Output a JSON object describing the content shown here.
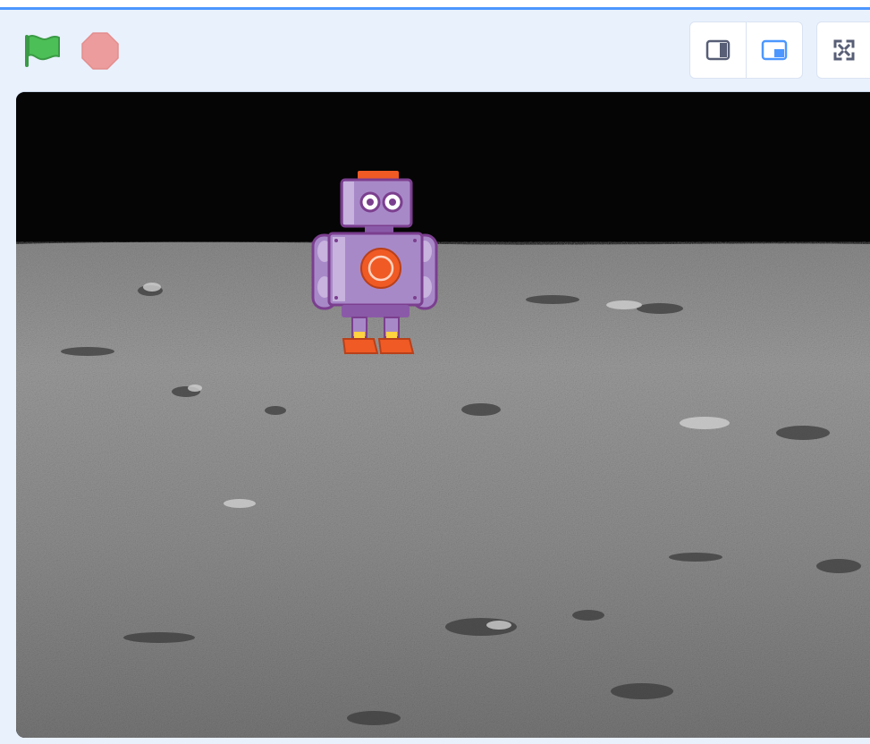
{
  "header": {
    "green_flag": {
      "icon": "green-flag-icon",
      "color": "#4cbf56"
    },
    "stop": {
      "icon": "stop-sign-icon",
      "color": "#ec9c9c"
    },
    "layout_buttons": [
      {
        "name": "small-stage-button",
        "icon": "small-stage-icon",
        "active": false
      },
      {
        "name": "normal-stage-button",
        "icon": "normal-stage-icon",
        "active": true
      },
      {
        "name": "fullscreen-button",
        "icon": "fullscreen-icon",
        "active": false
      }
    ],
    "accent_color": "#4c97ff"
  },
  "stage": {
    "backdrop": "moon-surface",
    "sprite": {
      "name": "robot",
      "colors": {
        "body": "#a889c8",
        "accent": "#f05a24",
        "trim": "#7b3f8f"
      }
    }
  }
}
